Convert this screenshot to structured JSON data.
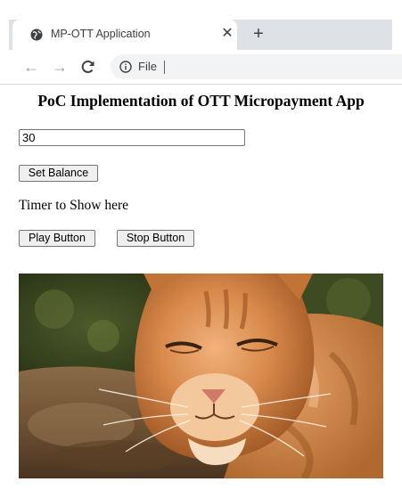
{
  "browser": {
    "tab_title": "MP-OTT Application",
    "tab_close": "✕",
    "new_tab": "+",
    "back": "←",
    "forward": "→",
    "reload": "C",
    "omnibox_label": "File",
    "icons": [
      "globe-icon",
      "info-icon",
      "back-arrow-icon",
      "forward-arrow-icon",
      "reload-icon",
      "close-icon",
      "plus-icon"
    ]
  },
  "page": {
    "title": "PoC Implementation of OTT Micropayment App",
    "balance_input_value": "30",
    "set_balance_label": "Set Balance",
    "timer_text": "Timer to Show here",
    "play_label": "Play Button",
    "stop_label": "Stop Button",
    "image_subject": "photo of an orange tabby cat lying outdoors"
  },
  "colors": {
    "tab_strip": "#dee1e6",
    "button_bg": "#efefef",
    "border": "#767676"
  }
}
